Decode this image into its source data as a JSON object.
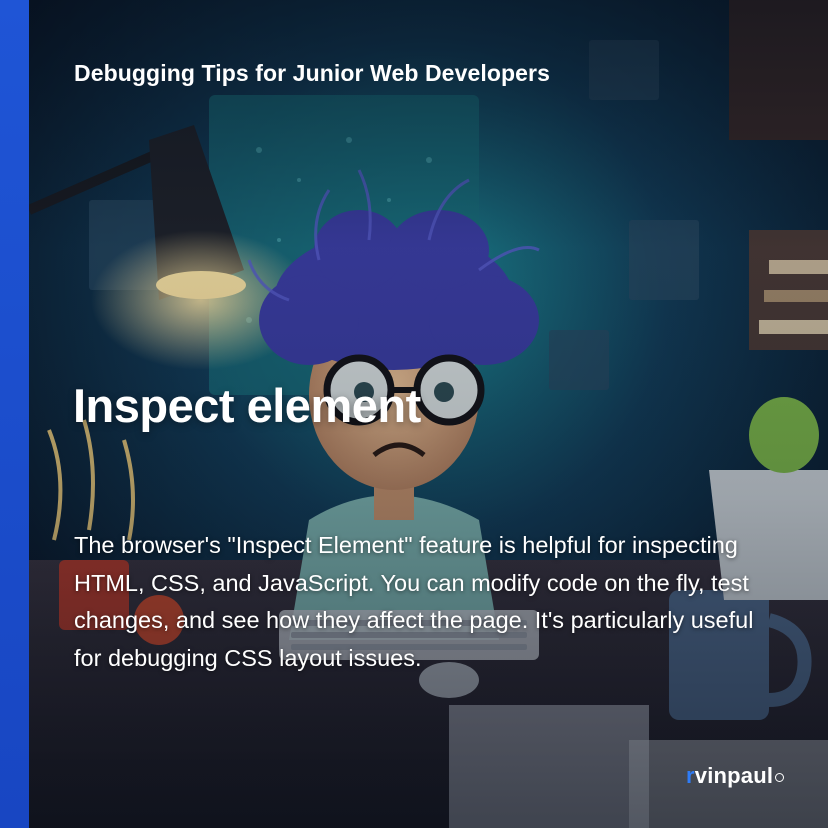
{
  "post": {
    "series_title": "Debugging Tips for Junior Web Developers",
    "heading": "Inspect element",
    "body": "The browser's \"Inspect Element\" feature is helpful for inspecting HTML, CSS, and JavaScript. You can modify code on the fly, test changes, and see how they affect the page. It's particularly useful for debugging CSS layout issues."
  },
  "brand": {
    "accent_letter": "r",
    "rest": "vinpaul",
    "accent_color": "#2f7cf6"
  },
  "colors": {
    "side_bar": "#1f55d6",
    "text": "#ffffff"
  },
  "illustration": {
    "subject": "stressed cartoon developer with wild blue hair and round glasses at a cluttered desk with desk lamp and keyboard"
  }
}
